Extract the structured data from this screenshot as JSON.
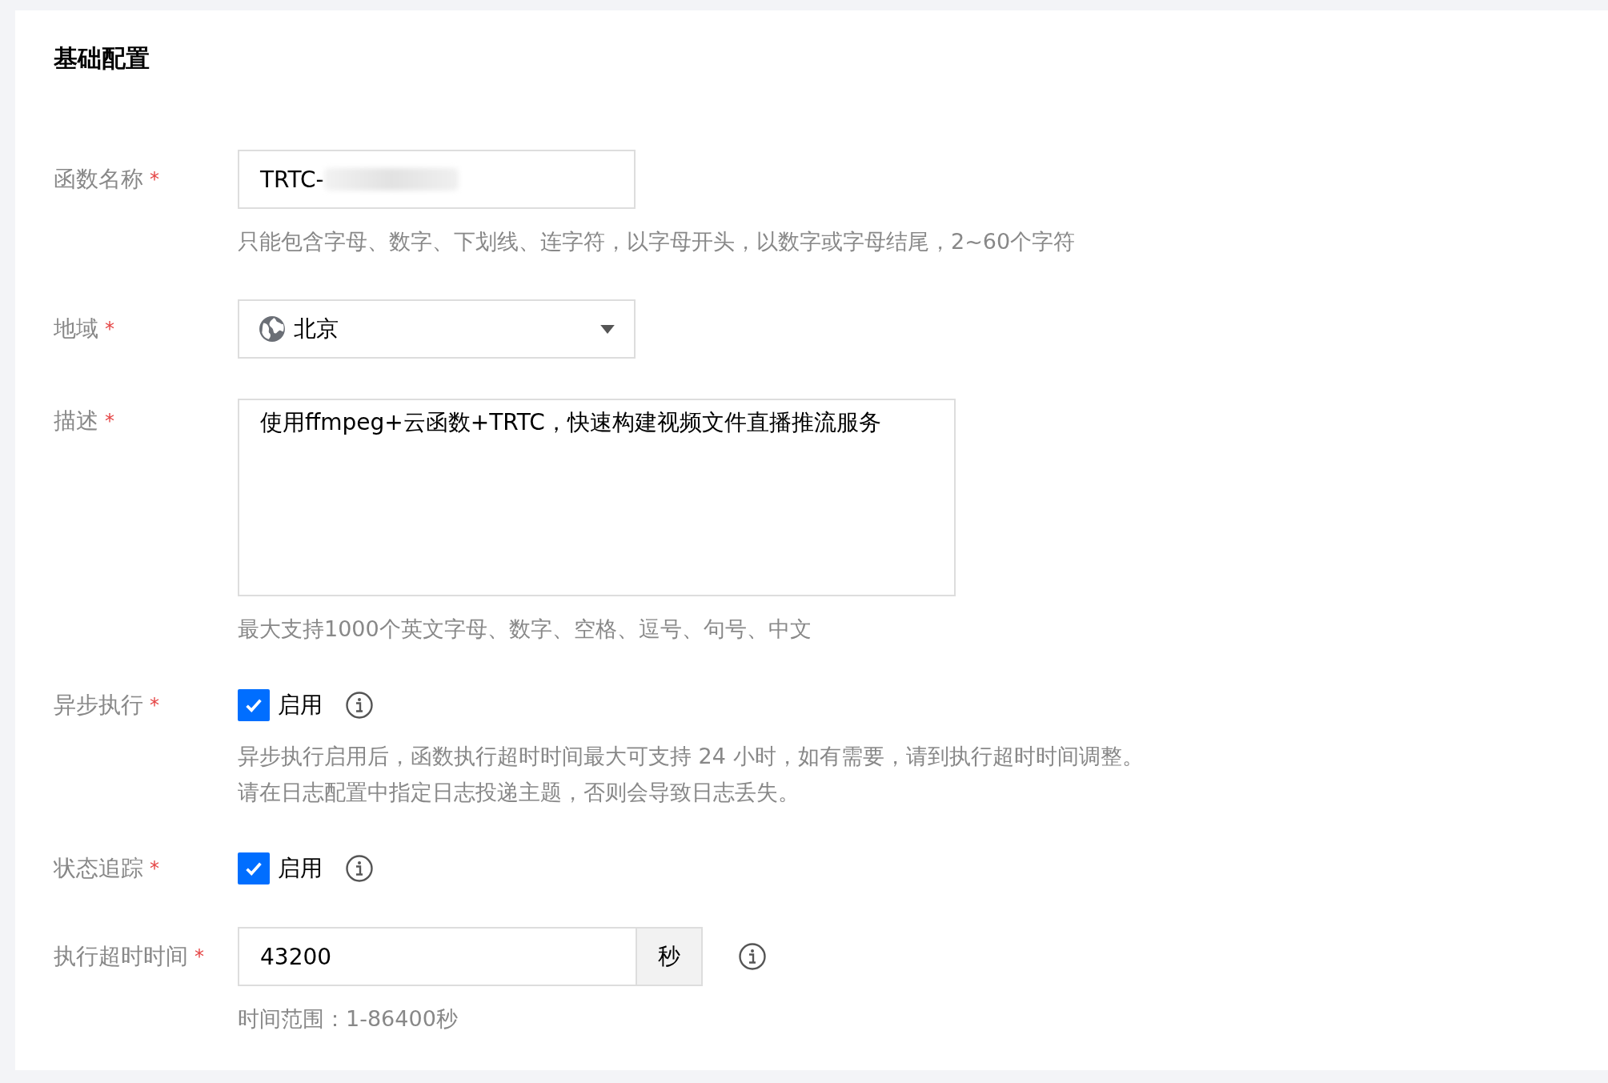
{
  "section": {
    "title": "基础配置"
  },
  "fields": [
    {
      "kind": "text",
      "label": "函数名称",
      "required_mark": "*",
      "value": "TRTC-",
      "blurred": true,
      "hints": [
        "只能包含字母、数字、下划线、连字符，以字母开头，以数字或字母结尾，2~60个字符"
      ]
    },
    {
      "kind": "select",
      "label": "地域",
      "required_mark": "*",
      "value": "北京"
    },
    {
      "kind": "textarea",
      "label": "描述",
      "required_mark": "*",
      "value": "使用ffmpeg+云函数+TRTC，快速构建视频文件直播推流服务",
      "hints": [
        "最大支持1000个英文字母、数字、空格、逗号、句号、中文"
      ]
    },
    {
      "kind": "checkbox",
      "label": "异步执行",
      "required_mark": "*",
      "checked": true,
      "option": "启用",
      "info": true,
      "hints": [
        "异步执行启用后，函数执行超时时间最大可支持 24 小时，如有需要，请到执行超时时间调整。",
        "请在日志配置中指定日志投递主题，否则会导致日志丢失。"
      ]
    },
    {
      "kind": "checkbox",
      "label": "状态追踪",
      "required_mark": "*",
      "checked": true,
      "option": "启用",
      "info": true
    },
    {
      "kind": "number",
      "label": "执行超时时间",
      "required_mark": "*",
      "value": "43200",
      "unit": "秒",
      "info": true,
      "hints": [
        "时间范围：1-86400秒"
      ]
    }
  ]
}
